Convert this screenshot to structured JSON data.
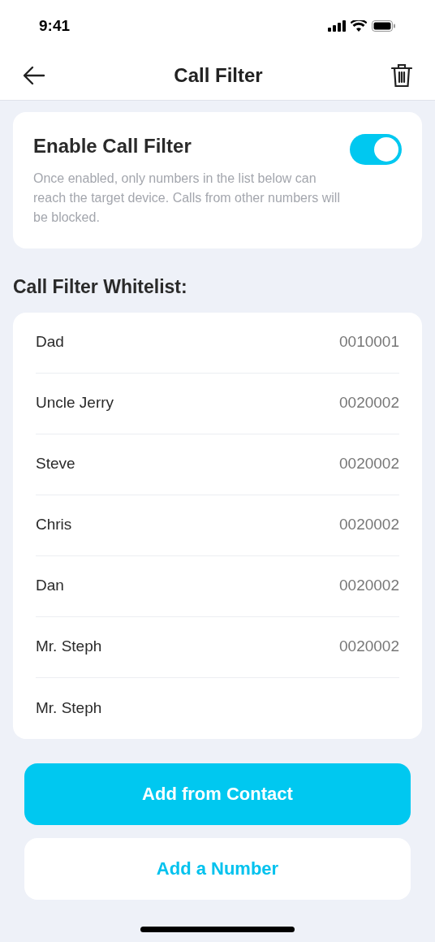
{
  "status_bar": {
    "time": "9:41"
  },
  "header": {
    "title": "Call Filter"
  },
  "enable_card": {
    "title": "Enable Call Filter",
    "on": true,
    "description": "Once enabled, only numbers in the list below can reach the target device. Calls from other numbers will be blocked."
  },
  "whitelist": {
    "heading": "Call Filter Whitelist:",
    "rows": [
      {
        "name": "Dad",
        "number": "0010001"
      },
      {
        "name": "Uncle Jerry",
        "number": "0020002"
      },
      {
        "name": "Steve",
        "number": "0020002"
      },
      {
        "name": "Chris",
        "number": "0020002"
      },
      {
        "name": "Dan",
        "number": "0020002"
      },
      {
        "name": "Mr. Steph",
        "number": "0020002"
      },
      {
        "name": "Mr. Steph"
      }
    ]
  },
  "buttons": [
    {
      "label": "Add from Contact",
      "kind": "primary"
    },
    {
      "label": "Add a Number",
      "kind": "secondary"
    }
  ]
}
